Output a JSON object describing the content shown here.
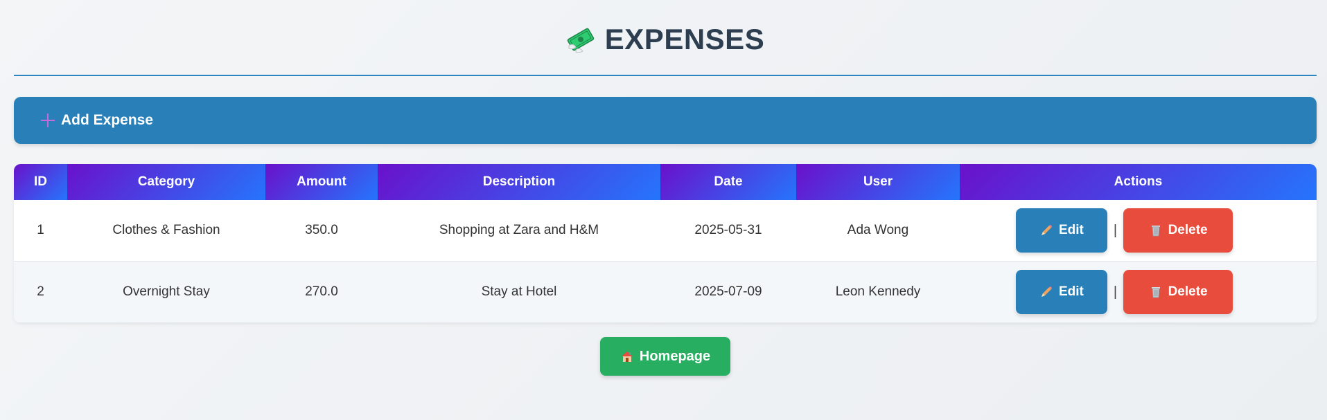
{
  "header": {
    "title": "EXPENSES",
    "icon": "money-with-wings-icon"
  },
  "add_bar": {
    "label": "Add Expense",
    "icon": "plus-icon"
  },
  "table": {
    "columns": [
      "ID",
      "Category",
      "Amount",
      "Description",
      "Date",
      "User",
      "Actions"
    ],
    "rows": [
      {
        "id": "1",
        "category": "Clothes & Fashion",
        "amount": "350.0",
        "description": "Shopping at Zara and H&M",
        "date": "2025-05-31",
        "user": "Ada Wong",
        "edit_label": "Edit",
        "separator": "|",
        "delete_label": "Delete"
      },
      {
        "id": "2",
        "category": "Overnight Stay",
        "amount": "270.0",
        "description": "Stay at Hotel",
        "date": "2025-07-09",
        "user": "Leon Kennedy",
        "edit_label": "Edit",
        "separator": "|",
        "delete_label": "Delete"
      }
    ]
  },
  "homepage_button": {
    "label": "Homepage",
    "icon": "house-icon"
  },
  "colors": {
    "accent_blue": "#2980b9",
    "header_gradient_start": "#6a11cb",
    "header_gradient_end": "#2575fc",
    "delete_red": "#e74c3c",
    "home_green": "#27ae60",
    "title_dark": "#2c3e50"
  }
}
